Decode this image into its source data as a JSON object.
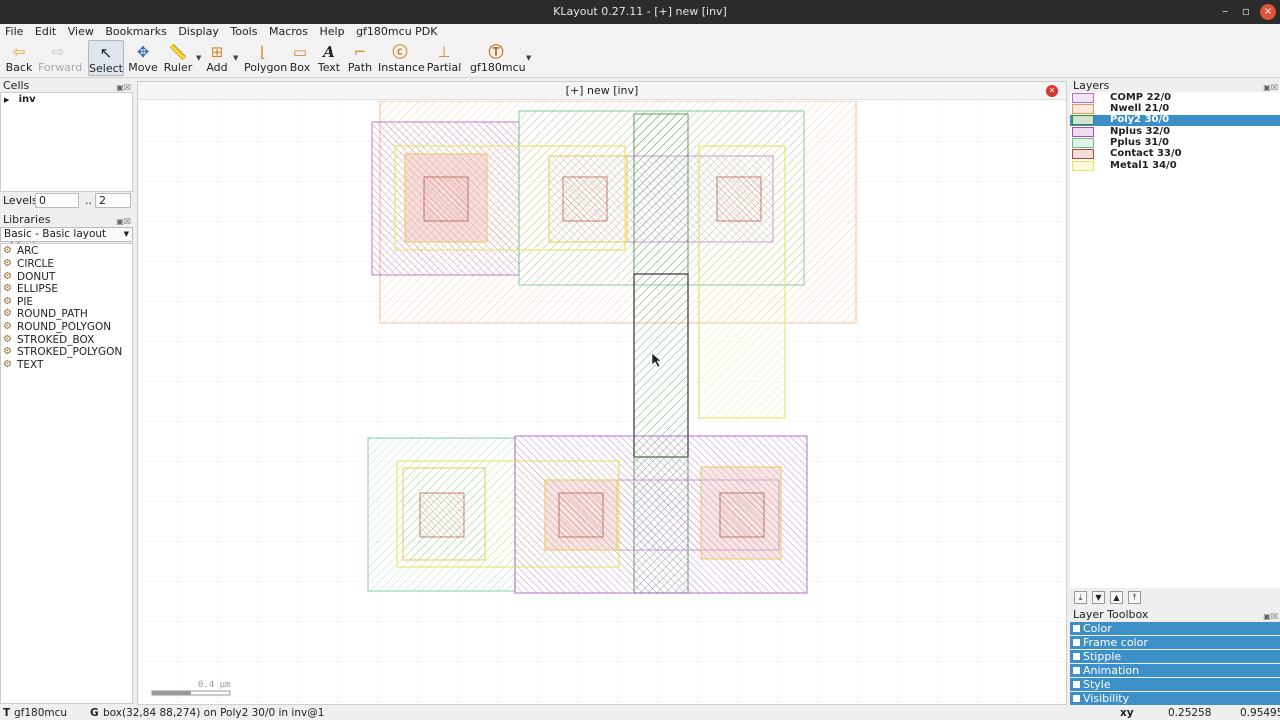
{
  "window": {
    "title": "KLayout 0.27.11 - [+] new [inv]",
    "minimize": "–",
    "maximize": "▫",
    "close": "×"
  },
  "menu": [
    "File",
    "Edit",
    "View",
    "Bookmarks",
    "Display",
    "Tools",
    "Macros",
    "Help",
    "gf180mcu PDK"
  ],
  "toolbar": {
    "back": "Back",
    "forward": "Forward",
    "select": "Select",
    "move": "Move",
    "ruler": "Ruler",
    "add": "Add",
    "polygon": "Polygon",
    "box": "Box",
    "text": "Text",
    "path": "Path",
    "instance": "Instance",
    "partial": "Partial",
    "pdk": "gf180mcu"
  },
  "cells": {
    "header": "Cells",
    "items": [
      "inv"
    ],
    "levels_label": "Levels",
    "level_min": "0",
    "level_sep": "..",
    "level_max": "2"
  },
  "libraries": {
    "header": "Libraries",
    "selected": "Basic - Basic layout object",
    "items": [
      "ARC",
      "CIRCLE",
      "DONUT",
      "ELLIPSE",
      "PIE",
      "ROUND_PATH",
      "ROUND_POLYGON",
      "STROKED_BOX",
      "STROKED_POLYGON",
      "TEXT"
    ]
  },
  "canvas": {
    "tab_title": "[+] new [inv]",
    "scale_label": "0.4 µm"
  },
  "layers": {
    "header": "Layers",
    "items": [
      {
        "name": "COMP 22/0",
        "color": "#b56fd1"
      },
      {
        "name": "Nwell 21/0",
        "color": "#e8955e"
      },
      {
        "name": "Poly2 30/0",
        "color": "#3a8a3a",
        "selected": true
      },
      {
        "name": "Nplus 32/0",
        "color": "#a04cc0"
      },
      {
        "name": "Pplus 31/0",
        "color": "#67c08a"
      },
      {
        "name": "Contact 33/0",
        "color": "#b04a3a"
      },
      {
        "name": "Metal1 34/0",
        "color": "#e6e35a"
      }
    ]
  },
  "toolbox": {
    "header": "Layer Toolbox",
    "items": [
      "Color",
      "Frame color",
      "Stipple",
      "Animation",
      "Style",
      "Visibility"
    ]
  },
  "status": {
    "tech": "gf180mcu",
    "mode": "G",
    "message": "box(32,84 88,274) on Poly2 30/0 in inv@1",
    "coord_label": "xy",
    "x": "0.25258",
    "y": "0.95495"
  }
}
